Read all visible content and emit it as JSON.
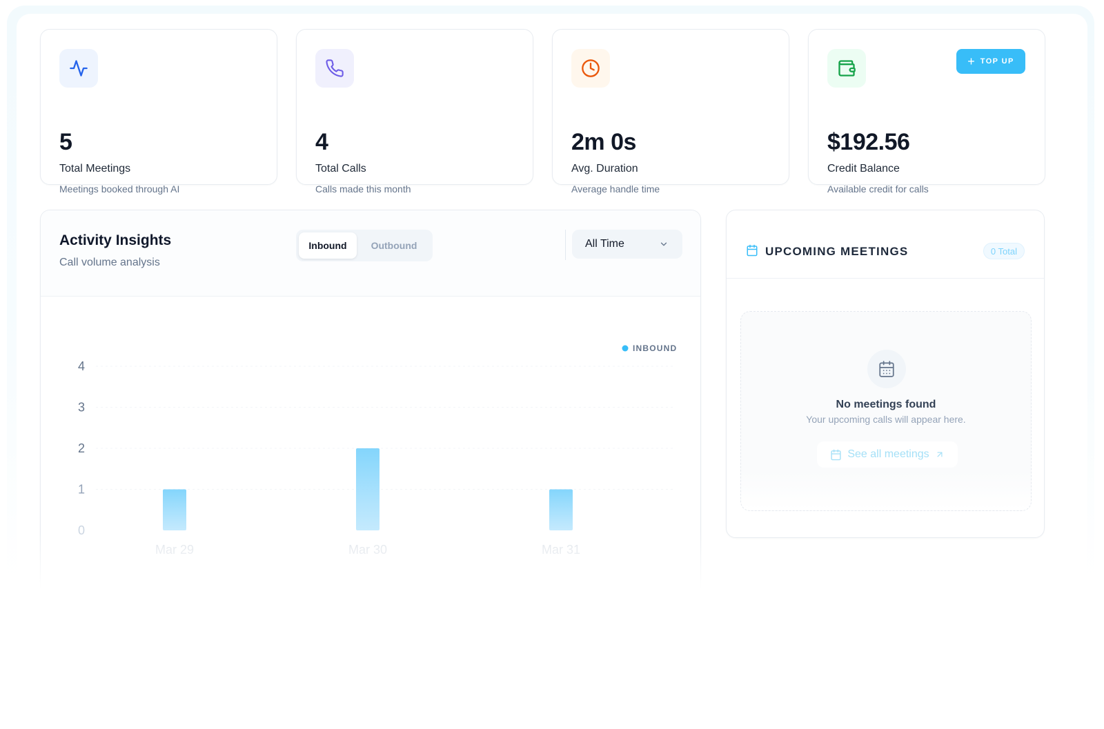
{
  "stats": [
    {
      "value": "5",
      "label": "Total Meetings",
      "sub": "Meetings booked through AI",
      "icon": "activity-icon",
      "icon_color": "#2563eb",
      "icon_bg": "#eef4fe"
    },
    {
      "value": "4",
      "label": "Total Calls",
      "sub": "Calls made this month",
      "icon": "phone-icon",
      "icon_color": "#6d5ce7",
      "icon_bg": "#f0f0fd"
    },
    {
      "value": "2m 0s",
      "label": "Avg. Duration",
      "sub": "Average handle time",
      "icon": "clock-icon",
      "icon_color": "#ea580c",
      "icon_bg": "#fff7ed"
    },
    {
      "value": "$192.56",
      "label": "Credit Balance",
      "sub": "Available credit for calls",
      "icon": "wallet-icon",
      "icon_color": "#16a34a",
      "icon_bg": "#ecfdf3"
    }
  ],
  "topup": {
    "label": "TOP UP",
    "color": "#38bdf8"
  },
  "activity": {
    "title": "Activity Insights",
    "subtitle": "Call volume analysis",
    "tabs": [
      {
        "label": "Inbound",
        "active": true
      },
      {
        "label": "Outbound",
        "active": false
      }
    ],
    "range": "All Time"
  },
  "chart_data": {
    "type": "bar",
    "categories": [
      "Mar 29",
      "Mar 30",
      "Mar 31"
    ],
    "series": [
      {
        "name": "INBOUND",
        "values": [
          1,
          2,
          1
        ],
        "color": "#7dd3fc"
      }
    ],
    "yticks": [
      "0",
      "1",
      "2",
      "3",
      "4"
    ],
    "ylim": [
      0,
      4
    ],
    "legend": "top-right",
    "grid": true,
    "title": "",
    "xlabel": "",
    "ylabel": ""
  },
  "meetings": {
    "title": "UPCOMING MEETINGS",
    "badge": "0 Total",
    "empty_title": "No meetings found",
    "empty_sub": "Your upcoming calls will appear here.",
    "link": "See all meetings"
  }
}
